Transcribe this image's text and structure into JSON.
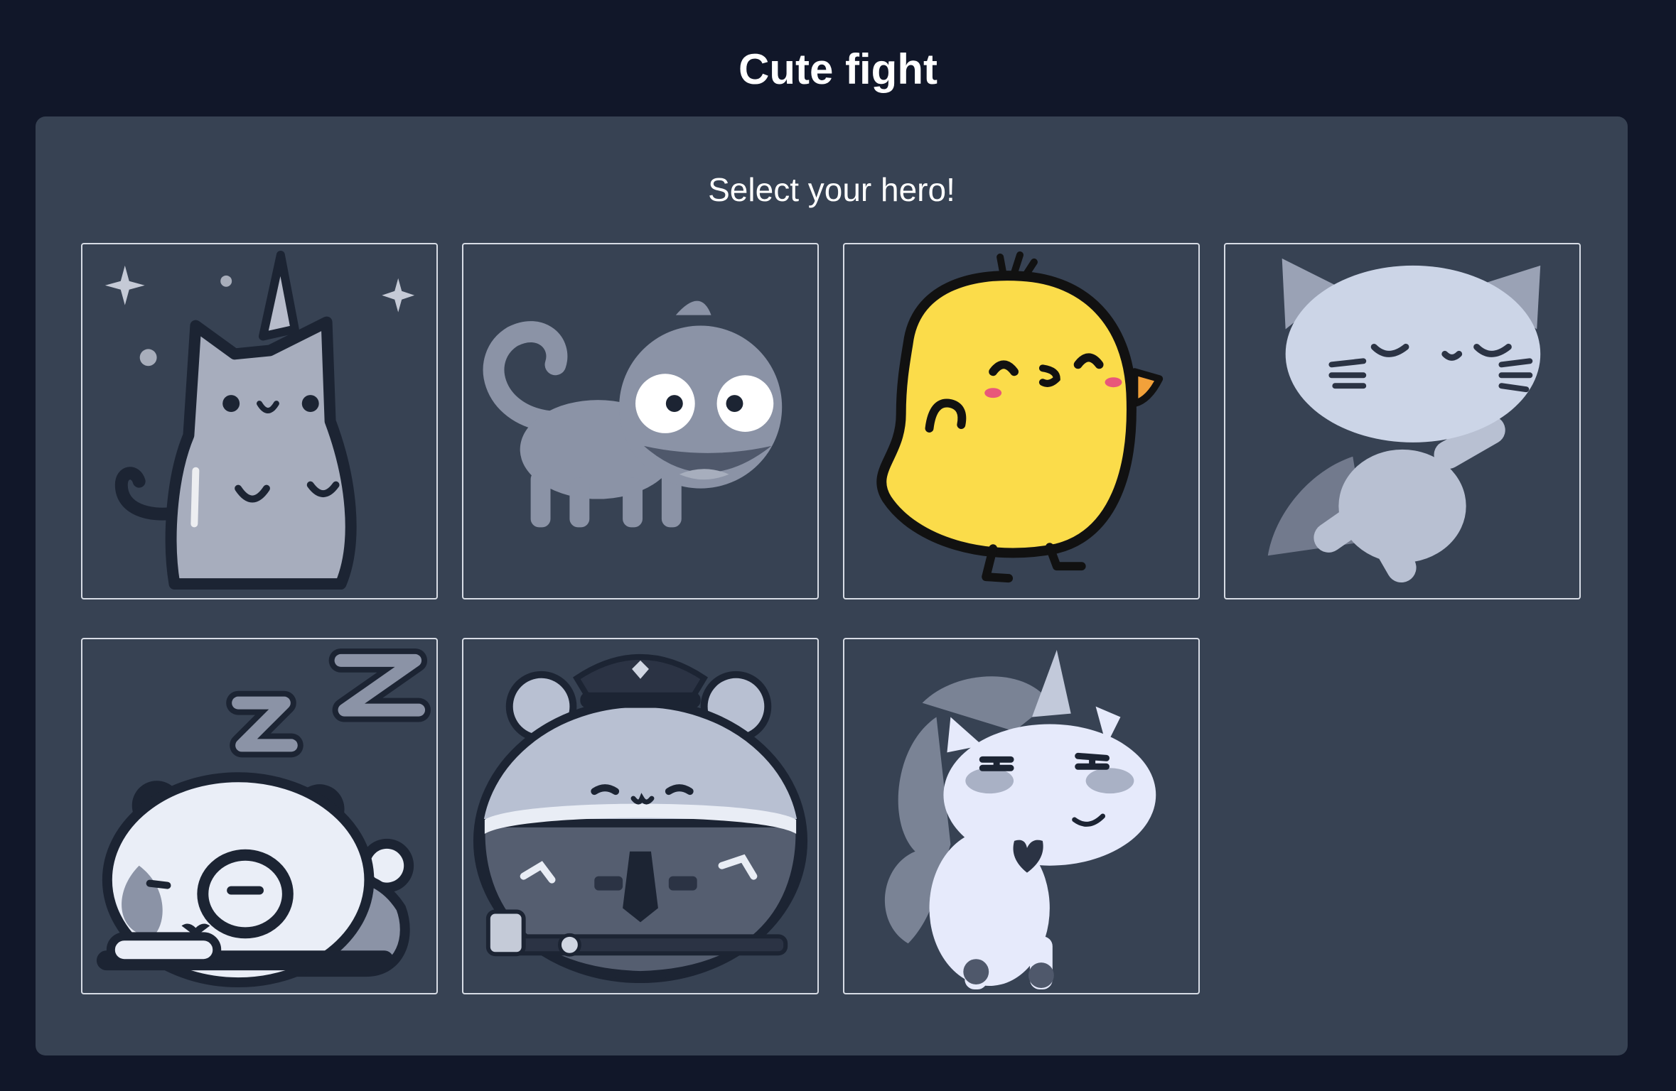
{
  "app": {
    "title": "Cute fight"
  },
  "selection": {
    "heading": "Select your hero!",
    "heroes": [
      {
        "icon": "unicorn-cat-icon",
        "state": "unselected"
      },
      {
        "icon": "chameleon-icon",
        "state": "unselected"
      },
      {
        "icon": "yellow-chick-icon",
        "state": "selected"
      },
      {
        "icon": "flying-cat-icon",
        "state": "unselected"
      },
      {
        "icon": "sleeping-panda-icon",
        "state": "unselected"
      },
      {
        "icon": "police-hamster-icon",
        "state": "unselected"
      },
      {
        "icon": "unicorn-icon",
        "state": "unselected"
      }
    ]
  },
  "colors": {
    "background": "#111729",
    "panel": "#374253",
    "card_border": "#d7dce5",
    "chick_yellow": "#fbdc4a"
  }
}
